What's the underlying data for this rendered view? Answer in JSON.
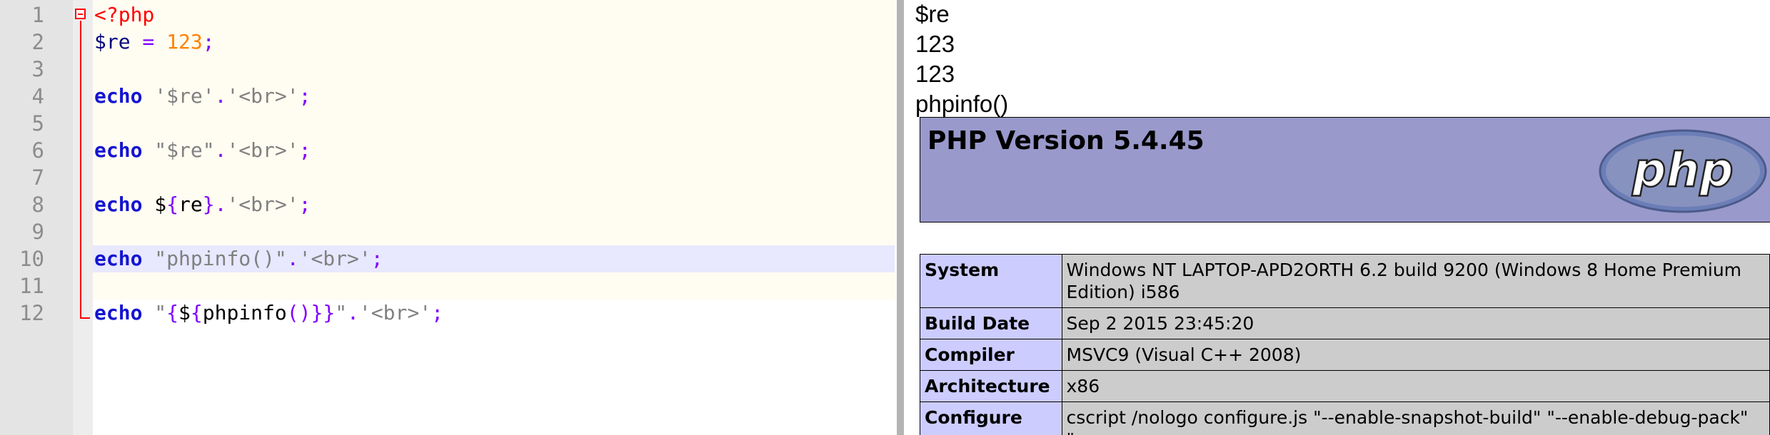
{
  "editor": {
    "line_numbers": [
      "1",
      "2",
      "3",
      "4",
      "5",
      "6",
      "7",
      "8",
      "9",
      "10",
      "11",
      "12"
    ],
    "lines": {
      "l1": {
        "open_tag": "<?php"
      },
      "l2": {
        "var": "$re",
        "op": " = ",
        "num": "123",
        "semi": ";"
      },
      "l4": {
        "kw": "echo",
        "str1": "'$re'",
        "dot": ".",
        "str2": "'<br>'",
        "semi": ";"
      },
      "l6": {
        "kw": "echo",
        "str1": "\"$re\"",
        "dot": ".",
        "str2": "'<br>'",
        "semi": ";"
      },
      "l8": {
        "kw": "echo",
        "dollar": "$",
        "lbrace": "{",
        "name": "re",
        "rbrace": "}",
        "dot": ".",
        "str2": "'<br>'",
        "semi": ";"
      },
      "l10": {
        "kw": "echo",
        "str1": "\"phpinfo()\"",
        "dot": ".",
        "str2": "'<br>'",
        "semi": ";"
      },
      "l12": {
        "kw": "echo",
        "q1": "\"",
        "lbrace": "{",
        "dollar": "$",
        "lbrace2": "{",
        "fn": "phpinfo",
        "parens": "()",
        "rbrace2": "}",
        "rbrace": "}",
        "q2": "\"",
        "dot": ".",
        "str2": "'<br>'",
        "semi": ";"
      }
    },
    "highlighted_line": 10
  },
  "output": {
    "lines": [
      "$re",
      "123",
      "123",
      "phpinfo()"
    ],
    "phpinfo": {
      "title": "PHP Version 5.4.45",
      "logo_text": "php",
      "rows": [
        {
          "key": "System",
          "value": "Windows NT LAPTOP-APD2ORTH 6.2 build 9200 (Windows 8 Home Premium Edition) i586"
        },
        {
          "key": "Build Date",
          "value": "Sep 2 2015 23:45:20"
        },
        {
          "key": "Compiler",
          "value": "MSVC9 (Visual C++ 2008)"
        },
        {
          "key": "Architecture",
          "value": "x86"
        },
        {
          "key": "Configure",
          "value": "cscript /nologo configure.js \"--enable-snapshot-build\" \"--enable-debug-pack\" \"--"
        }
      ]
    }
  },
  "colors": {
    "keyword": "#1414d2",
    "string": "#808080",
    "operator": "#8000ff",
    "number": "#ff8000",
    "php_tag": "#ff0000",
    "phpinfo_header": "#9999cc",
    "phpinfo_key": "#ccccff",
    "phpinfo_value": "#cccccc"
  }
}
